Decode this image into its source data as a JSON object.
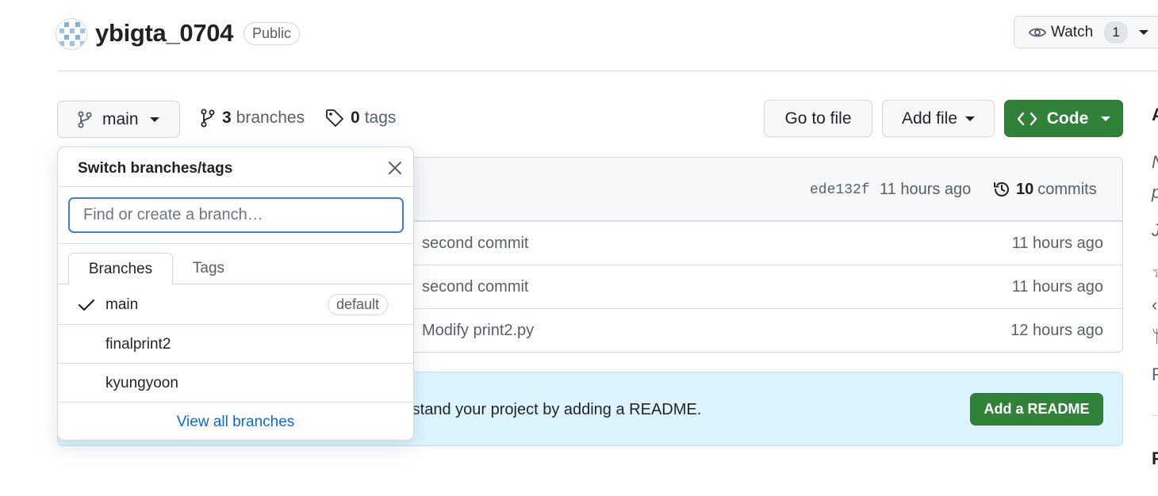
{
  "repo": {
    "name": "ybigta_0704",
    "visibility": "Public",
    "watch_label": "Watch",
    "watch_count": "1"
  },
  "toolbar": {
    "branch": "main",
    "branches_count": "3",
    "branches_label": "branches",
    "tags_count": "0",
    "tags_label": "tags",
    "goto_file": "Go to file",
    "add_file": "Add file",
    "code": "Code"
  },
  "commit_header": {
    "sha": "ede132f",
    "time": "11 hours ago",
    "commits_count": "10",
    "commits_label": "commits"
  },
  "files": [
    {
      "message": "second commit",
      "time": "11 hours ago"
    },
    {
      "message": "second commit",
      "time": "11 hours ago"
    },
    {
      "message": "Modify print2.py",
      "time": "12 hours ago"
    }
  ],
  "readme_banner": {
    "text": "rstand your project by adding a README.",
    "button": "Add a README"
  },
  "branch_popover": {
    "title": "Switch branches/tags",
    "search_placeholder": "Find or create a branch…",
    "tabs": [
      "Branches",
      "Tags"
    ],
    "branches": [
      {
        "name": "main",
        "badge": "default",
        "selected": true
      },
      {
        "name": "finalprint2"
      },
      {
        "name": "kyungyoon"
      }
    ],
    "view_all": "View all branches"
  },
  "colors": {
    "primary_green": "#2f8238",
    "link_blue": "#0969da",
    "banner_bg": "#ddf4ff",
    "focus_blue": "#3c7fd8"
  }
}
